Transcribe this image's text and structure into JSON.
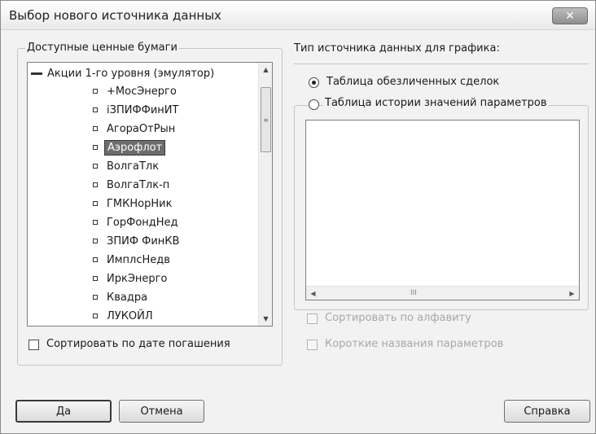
{
  "dialog": {
    "title": "Выбор нового источника данных",
    "close_label": "✕"
  },
  "securities": {
    "group_label": "Доступные ценные бумаги",
    "root_label": "Акции 1-го уровня (эмулятор)",
    "items": [
      {
        "label": "+МосЭнерго"
      },
      {
        "label": "iЗПИФФинИТ"
      },
      {
        "label": "АгораОтРын"
      },
      {
        "label": "Аэрофлот",
        "selected": true
      },
      {
        "label": "ВолгаТлк"
      },
      {
        "label": "ВолгаТлк-п"
      },
      {
        "label": "ГМКНорНик"
      },
      {
        "label": "ГорФондНед"
      },
      {
        "label": "ЗПИФ ФинКВ"
      },
      {
        "label": "ИмплсНедв"
      },
      {
        "label": "ИркЭнерго"
      },
      {
        "label": "Квадра"
      },
      {
        "label": "ЛУКОЙЛ"
      }
    ],
    "sort_by_maturity_label": "Сортировать по дате погашения",
    "sort_by_maturity_checked": false
  },
  "source_type": {
    "heading": "Тип источника данных для графика:",
    "option_anonymous_trades": "Таблица обезличенных сделок",
    "option_param_history": "Таблица истории значений параметров",
    "selected": "anonymous_trades",
    "sort_alpha_label": "Сортировать по алфавиту",
    "short_names_label": "Короткие названия параметров",
    "scroll_grip": "III"
  },
  "buttons": {
    "ok": "Да",
    "cancel": "Отмена",
    "help": "Справка"
  },
  "icons": {
    "close": "close-icon",
    "collapse": "minus-collapse-icon",
    "bullet": "bullet-icon",
    "scroll_up": "chevron-up-icon",
    "scroll_down": "chevron-down-icon",
    "scroll_left": "chevron-left-icon",
    "scroll_right": "chevron-right-icon"
  }
}
